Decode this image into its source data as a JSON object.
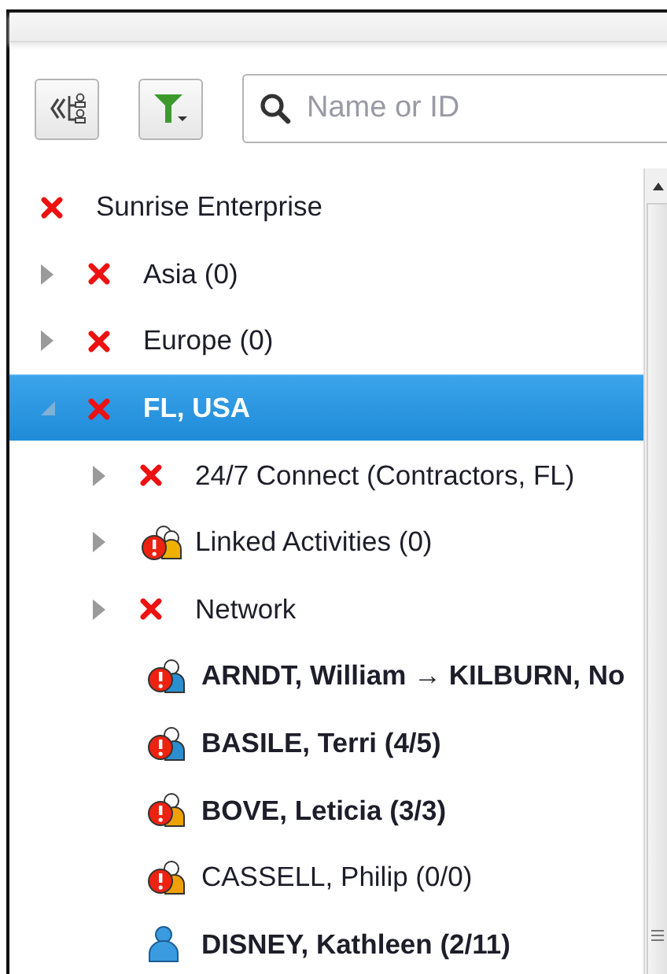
{
  "toolbar": {
    "search": {
      "placeholder": "Name or ID"
    }
  },
  "tree": [
    {
      "label": "Sunrise Enterprise",
      "kind": "error",
      "bold": false,
      "selected": false,
      "children": [
        {
          "label": "Asia (0)",
          "kind": "error",
          "bold": false,
          "selected": false,
          "expanded": false
        },
        {
          "label": "Europe (0)",
          "kind": "error",
          "bold": false,
          "selected": false,
          "expanded": false
        },
        {
          "label": "FL, USA",
          "kind": "error",
          "bold": true,
          "selected": true,
          "expanded": true,
          "children": [
            {
              "label": "24/7 Connect (Contractors, FL)",
              "kind": "error",
              "bold": false,
              "selected": false,
              "expanded": false
            },
            {
              "label": "Linked Activities (0)",
              "kind": "alert-group",
              "bold": false,
              "selected": false,
              "expanded": false
            },
            {
              "label": "Network",
              "kind": "error",
              "bold": false,
              "selected": false,
              "expanded": false
            },
            {
              "label": "ARNDT, William → KILBURN, No",
              "kind": "alert-person-blue",
              "bold": true,
              "selected": false
            },
            {
              "label": "BASILE, Terri (4/5)",
              "kind": "alert-person-blue",
              "bold": true,
              "selected": false
            },
            {
              "label": "BOVE, Leticia (3/3)",
              "kind": "alert-person-orange",
              "bold": true,
              "selected": false
            },
            {
              "label": "CASSELL, Philip (0/0)",
              "kind": "alert-person-orange",
              "bold": false,
              "selected": false
            },
            {
              "label": "DISNEY, Kathleen (2/11)",
              "kind": "person",
              "bold": true,
              "selected": false
            }
          ]
        }
      ]
    }
  ]
}
